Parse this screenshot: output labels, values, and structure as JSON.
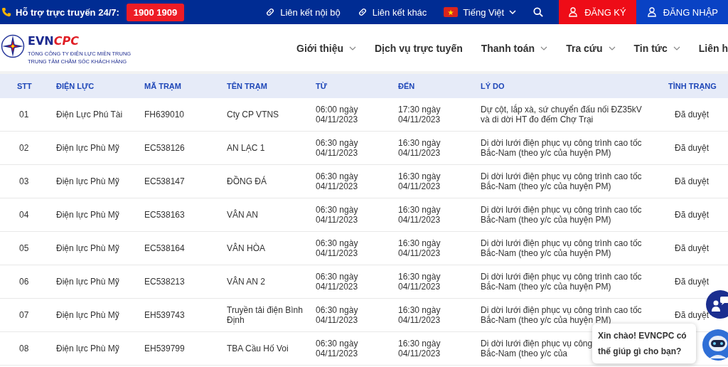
{
  "topbar": {
    "support_label": "Hỗ trợ trực truyến 24/7:",
    "hotline": "1900 1909",
    "links": [
      "Liên kết nội bộ",
      "Liên kết khác"
    ],
    "language": "Tiếng Việt",
    "register": "ĐĂNG KÝ",
    "login": "ĐĂNG NHẬP"
  },
  "logo": {
    "brand_a": "EVN",
    "brand_b": "CPC",
    "line1": "TỔNG CÔNG TY ĐIỆN LỰC MIỀN TRUNG",
    "line2": "TRUNG TÂM CHĂM SÓC KHÁCH HÀNG"
  },
  "nav": [
    {
      "label": "Giới thiệu",
      "has_menu": true
    },
    {
      "label": "Dịch vụ trực tuyến",
      "has_menu": false
    },
    {
      "label": "Thanh toán",
      "has_menu": true
    },
    {
      "label": "Tra cứu",
      "has_menu": true
    },
    {
      "label": "Tin tức",
      "has_menu": true
    },
    {
      "label": "Liên h",
      "has_menu": false
    }
  ],
  "table": {
    "columns": [
      "STT",
      "ĐIỆN LỰC",
      "MÃ TRẠM",
      "TÊN TRẠM",
      "TỪ",
      "ĐẾN",
      "LÝ DO",
      "TÌNH TRẠNG"
    ],
    "rows": [
      {
        "stt": "01",
        "unit": "Điện Lực Phú Tài",
        "code": "FH639010",
        "station": "Cty CP VTNS",
        "from": [
          "06:00 ngày",
          "04/11/2023"
        ],
        "to": [
          "17:30 ngày",
          "04/11/2023"
        ],
        "reason": [
          "Dự cột, lắp xà, sứ chuyển đấu nối ĐZ35kV",
          "và di dời HT đo đếm Chợ Trại"
        ],
        "status": "Đã duyệt"
      },
      {
        "stt": "02",
        "unit": "Điện lực Phù Mỹ",
        "code": "EC538126",
        "station": "AN LẠC 1",
        "from": [
          "06:30 ngày",
          "04/11/2023"
        ],
        "to": [
          "16:30 ngày",
          "04/11/2023"
        ],
        "reason": [
          "Di dời lưới điện phục vụ công trình cao tốc",
          "Bắc-Nam (theo y/c của huyện PM)"
        ],
        "status": "Đã duyệt"
      },
      {
        "stt": "03",
        "unit": "Điện lực Phù Mỹ",
        "code": "EC538147",
        "station": "ĐỒNG ĐÁ",
        "from": [
          "06:30 ngày",
          "04/11/2023"
        ],
        "to": [
          "16:30 ngày",
          "04/11/2023"
        ],
        "reason": [
          "Di dời lưới điện phục vụ công trình cao tốc",
          "Bắc-Nam (theo y/c của huyện PM)"
        ],
        "status": "Đã duyệt"
      },
      {
        "stt": "04",
        "unit": "Điện lực Phù Mỹ",
        "code": "EC538163",
        "station": "VÂN AN",
        "from": [
          "06:30 ngày",
          "04/11/2023"
        ],
        "to": [
          "16:30 ngày",
          "04/11/2023"
        ],
        "reason": [
          "Di dời lưới điện phục vụ công trình cao tốc",
          "Bắc-Nam (theo y/c của huyện PM)"
        ],
        "status": "Đã duyệt"
      },
      {
        "stt": "05",
        "unit": "Điện lực Phù Mỹ",
        "code": "EC538164",
        "station": "VÂN HÒA",
        "from": [
          "06:30 ngày",
          "04/11/2023"
        ],
        "to": [
          "16:30 ngày",
          "04/11/2023"
        ],
        "reason": [
          "Di dời lưới điện phục vụ công trình cao tốc",
          "Bắc-Nam (theo y/c của huyện PM)"
        ],
        "status": "Đã duyệt"
      },
      {
        "stt": "06",
        "unit": "Điện lực Phù Mỹ",
        "code": "EC538213",
        "station": "VÂN AN 2",
        "from": [
          "06:30 ngày",
          "04/11/2023"
        ],
        "to": [
          "16:30 ngày",
          "04/11/2023"
        ],
        "reason": [
          "Di dời lưới điện phục vụ công trình cao tốc",
          "Bắc-Nam (theo y/c của huyện PM)"
        ],
        "status": "Đã duyệt"
      },
      {
        "stt": "07",
        "unit": "Điện lực Phù Mỹ",
        "code": "EH539743",
        "station": "Truyền tải điện Bình Định",
        "from": [
          "06:30 ngày",
          "04/11/2023"
        ],
        "to": [
          "16:30 ngày",
          "04/11/2023"
        ],
        "reason": [
          "Di dời lưới điện phục vụ công trình cao tốc",
          "Bắc-Nam (theo y/c của huyện PM)"
        ],
        "status": "Đã duyệt"
      },
      {
        "stt": "08",
        "unit": "Điện lực Phù Mỹ",
        "code": "EH539799",
        "station": "TBA Cầu Hố Voi",
        "from": [
          "06:30 ngày",
          "04/11/2023"
        ],
        "to": [
          "16:30 ngày",
          "04/11/2023"
        ],
        "reason": [
          "Di dời lưới điện phục vụ công",
          "Bắc-Nam (theo y/c của"
        ]
      }
    ]
  },
  "chat": {
    "greeting": "Xin chào! EVNCPC có thế giúp gì cho bạn?"
  }
}
